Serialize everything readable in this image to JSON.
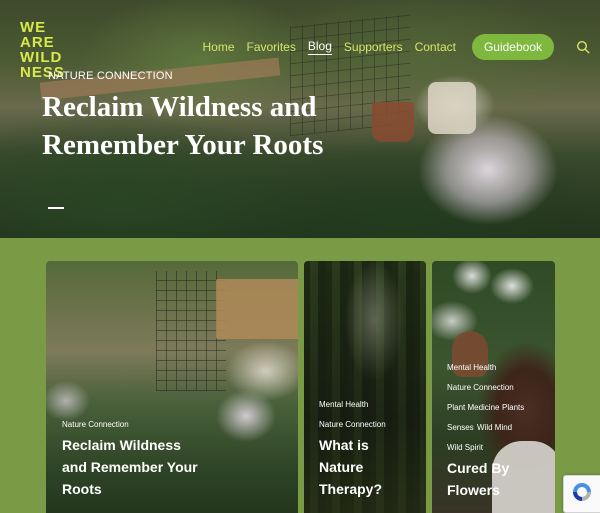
{
  "brand": {
    "logo_lines": [
      "WE ARE",
      "WILD",
      "NESS"
    ],
    "logo_color": "#d8e94a"
  },
  "nav": {
    "items": [
      {
        "label": "Home",
        "active": false
      },
      {
        "label": "Favorites",
        "active": false
      },
      {
        "label": "Blog",
        "active": true
      },
      {
        "label": "Supporters",
        "active": false
      },
      {
        "label": "Contact",
        "active": false
      }
    ],
    "cta_label": "Guidebook",
    "search_icon": "search-icon"
  },
  "hero": {
    "category": "NATURE CONNECTION",
    "title": "Reclaim Wildness and Remember Your Roots",
    "slides_total": 1,
    "active_slide": 1
  },
  "cards": [
    {
      "tags": [
        "Nature Connection"
      ],
      "title": "Reclaim Wildness and Remember Your Roots"
    },
    {
      "tags": [
        "Mental Health",
        "Nature Connection"
      ],
      "title": "What is Nature Therapy?"
    },
    {
      "tags": [
        "Mental Health",
        "Nature Connection",
        "Plant Medicine",
        "Plants",
        "Senses",
        "Wild Mind",
        "Wild Spirit"
      ],
      "title": "Cured By Flowers"
    }
  ],
  "colors": {
    "page_bg": "#7a9a45",
    "nav_link": "#d6e56a",
    "cta_bg": "#7fb83e"
  },
  "recaptcha_icon": "recaptcha-icon"
}
